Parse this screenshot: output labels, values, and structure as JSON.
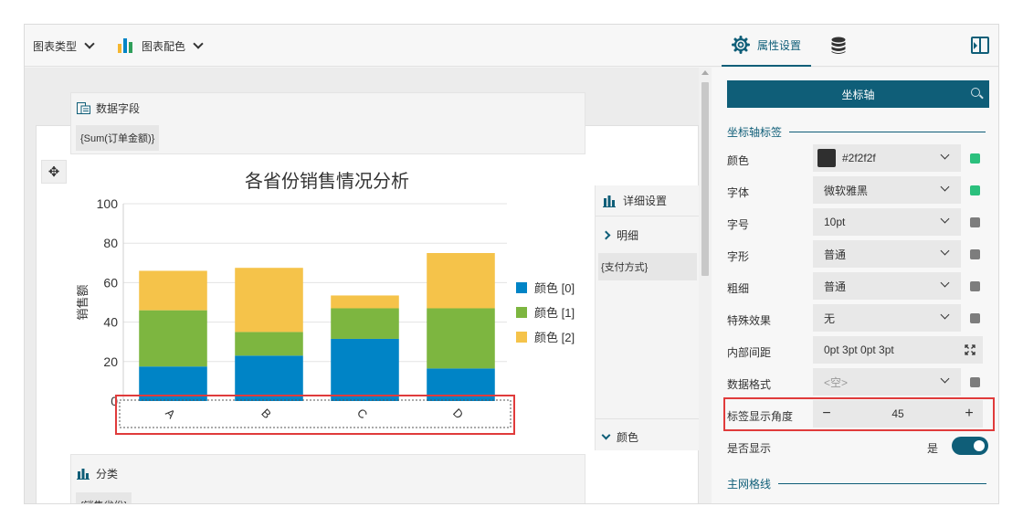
{
  "toolbar": {
    "chart_type_label": "图表类型",
    "chart_color_label": "图表配色",
    "property_tab_label": "属性设置",
    "icons": [
      "chevron-down-icon",
      "bar-chart-icon",
      "gear-icon",
      "database-icon",
      "panel-collapse-icon"
    ],
    "bar_icon_colors": [
      "#f5b731",
      "#0084c6",
      "#2f9f5a"
    ]
  },
  "canvas": {
    "data_field": {
      "title": "数据字段",
      "chip": "{Sum(订单金额)}"
    },
    "category": {
      "title": "分类",
      "chip": "{销售省份}"
    },
    "detail": {
      "title": "详细设置",
      "items": [
        "明细",
        "{支付方式}",
        "颜色"
      ]
    }
  },
  "chart_data": {
    "type": "bar",
    "stacked": true,
    "title": "各省份销售情况分析",
    "ylabel": "销售额",
    "xlabel": "",
    "categories": [
      "A",
      "B",
      "C",
      "D"
    ],
    "category_label_angle": 45,
    "ylim": [
      0,
      100
    ],
    "yticks": [
      0,
      20,
      40,
      60,
      80,
      100
    ],
    "grid": true,
    "legend_position": "right",
    "series": [
      {
        "name": "颜色 [0]",
        "color": "#0084c6",
        "values": [
          17.5,
          23,
          31.5,
          16.5
        ]
      },
      {
        "name": "颜色 [1]",
        "color": "#7db640",
        "values": [
          28.5,
          12,
          15.5,
          30.5
        ]
      },
      {
        "name": "颜色 [2]",
        "color": "#f5c34a",
        "values": [
          20,
          32.5,
          6.5,
          28
        ]
      }
    ]
  },
  "right_panel": {
    "section_button": "坐标轴",
    "group_axis_label": "坐标轴标签",
    "props": [
      {
        "label": "颜色",
        "value": "#2f2f2f",
        "swatch": "#2f2f2f",
        "active": true
      },
      {
        "label": "字体",
        "value": "微软雅黑",
        "active": true
      },
      {
        "label": "字号",
        "value": "10pt",
        "active": false
      },
      {
        "label": "字形",
        "value": "普通",
        "active": false
      },
      {
        "label": "粗细",
        "value": "普通",
        "active": false
      },
      {
        "label": "特殊效果",
        "value": "无",
        "active": false
      },
      {
        "label": "内部间距",
        "value": "0pt 3pt 0pt 3pt"
      },
      {
        "label": "数据格式",
        "value": "<空>",
        "active": false
      }
    ],
    "angle": {
      "label": "标签显示角度",
      "value": "45",
      "minus": "−",
      "plus": "+"
    },
    "show": {
      "label": "是否显示",
      "value": "是",
      "on": true
    },
    "group_major_grid": "主网格线",
    "indicator_colors": {
      "on": "#2bc07d",
      "off": "#7d7d7d"
    }
  }
}
